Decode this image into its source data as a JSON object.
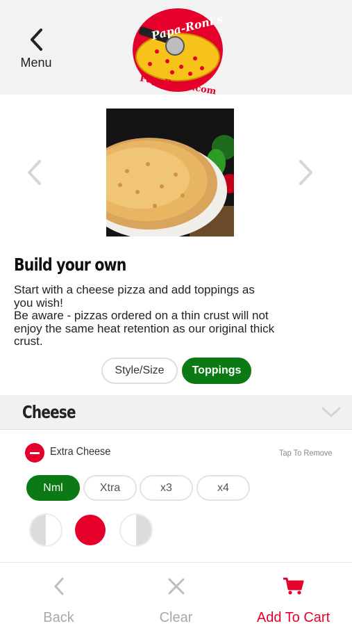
{
  "header": {
    "menu_label": "Menu",
    "logo_text_top": "Papa-Roni's",
    "logo_text_bottom": "PapaRonis.com"
  },
  "item": {
    "title": "Build your own",
    "description_lines": [
      "Start with a cheese pizza and add toppings as",
      "you wish!",
      "Be aware - pizzas ordered on a thin crust will not",
      "enjoy the same heat retention as our original thick",
      "crust."
    ]
  },
  "tabs": [
    {
      "label": "Style/Size",
      "selected": false
    },
    {
      "label": "Toppings",
      "selected": true
    }
  ],
  "section": {
    "title": "Cheese",
    "topping": {
      "name": "Extra Cheese",
      "remove_hint": "Tap To Remove",
      "amounts": [
        {
          "label": "Nml",
          "selected": true
        },
        {
          "label": "Xtra",
          "selected": false
        },
        {
          "label": "x3",
          "selected": false
        },
        {
          "label": "x4",
          "selected": false
        }
      ],
      "portion_selected": "whole"
    }
  },
  "bottom_bar": {
    "back_label": "Back",
    "clear_label": "Clear",
    "cart_label": "Add To Cart"
  },
  "colors": {
    "accent_green": "#0b7a14",
    "accent_red": "#e4002b",
    "muted_gray": "#a8a8a8"
  },
  "icons": {
    "menu": "chevron-left-icon",
    "carousel_prev": "chevron-left-icon",
    "carousel_next": "chevron-right-icon",
    "collapse": "chevron-down-icon",
    "back": "chevron-left-icon",
    "clear": "close-icon",
    "cart": "cart-icon"
  }
}
